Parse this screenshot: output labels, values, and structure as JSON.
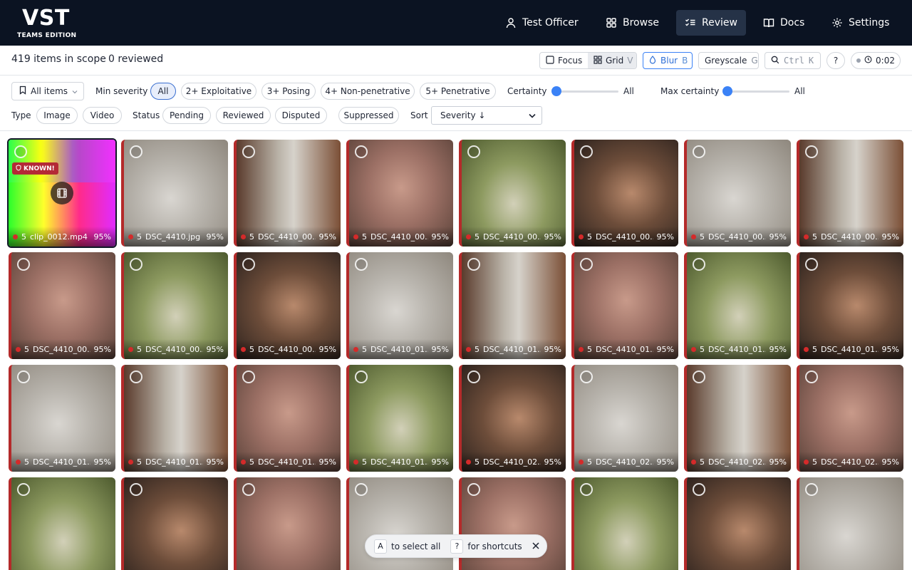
{
  "logo": {
    "title": "VST",
    "edition": "TEAMS EDITION"
  },
  "nav": [
    {
      "label": "Test Officer",
      "icon": "user-icon"
    },
    {
      "label": "Browse",
      "icon": "grid-icon"
    },
    {
      "label": "Review",
      "icon": "checklist-icon",
      "active": true
    },
    {
      "label": "Docs",
      "icon": "book-icon"
    },
    {
      "label": "Settings",
      "icon": "gear-icon"
    }
  ],
  "summary": {
    "in_scope": "419 items in scope",
    "reviewed": "0 reviewed",
    "focus_label": "Focus",
    "grid_label": "Grid",
    "grid_key": "V",
    "blur_label": "Blur",
    "blur_key": "B",
    "greyscale_label": "Greyscale",
    "greyscale_key": "G",
    "search_label": "Ctrl",
    "search_key": "K",
    "help_label": "?",
    "timer": "0:02"
  },
  "filters": {
    "scope_dropdown": "All items",
    "min_severity_label": "Min severity",
    "severity_options": [
      "All",
      "2+ Exploitative",
      "3+ Posing",
      "4+ Non-penetrative",
      "5+ Penetrative"
    ],
    "severity_selected": "All",
    "certainty_label": "Certainty",
    "certainty_value": "All",
    "certainty_level": 0,
    "max_certainty_label": "Max certainty",
    "max_certainty_value": "All",
    "max_certainty_level": 0,
    "type_label": "Type",
    "type_options": [
      "Image",
      "Video"
    ],
    "status_label": "Status",
    "status_options": [
      "Pending",
      "Reviewed",
      "Disputed",
      "Suppressed"
    ],
    "sort_label": "Sort",
    "sort_value": "Severity ↓"
  },
  "grid": {
    "tiles": [
      {
        "severity": "5",
        "name": "clip_0012.mp4",
        "certainty": "95%",
        "tone": "rainbow",
        "known": "KNOWN!",
        "video": true,
        "selected": true
      },
      {
        "severity": "5",
        "name": "DSC_4410.jpg",
        "certainty": "95%",
        "tone": "grey"
      },
      {
        "severity": "5",
        "name": "DSC_4410_00...",
        "certainty": "95%",
        "tone": "brown"
      },
      {
        "severity": "5",
        "name": "DSC_4410_00...",
        "certainty": "95%",
        "tone": "warm"
      },
      {
        "severity": "5",
        "name": "DSC_4410_00...",
        "certainty": "95%",
        "tone": "green"
      },
      {
        "severity": "5",
        "name": "DSC_4410_00...",
        "certainty": "95%",
        "tone": "dark"
      },
      {
        "severity": "5",
        "name": "DSC_4410_00...",
        "certainty": "95%",
        "tone": "grey"
      },
      {
        "severity": "5",
        "name": "DSC_4410_00...",
        "certainty": "95%",
        "tone": "brown"
      },
      {
        "severity": "5",
        "name": "DSC_4410_00...",
        "certainty": "95%",
        "tone": "warm"
      },
      {
        "severity": "5",
        "name": "DSC_4410_00...",
        "certainty": "95%",
        "tone": "green"
      },
      {
        "severity": "5",
        "name": "DSC_4410_00...",
        "certainty": "95%",
        "tone": "dark"
      },
      {
        "severity": "5",
        "name": "DSC_4410_01...",
        "certainty": "95%",
        "tone": "grey"
      },
      {
        "severity": "5",
        "name": "DSC_4410_01...",
        "certainty": "95%",
        "tone": "brown"
      },
      {
        "severity": "5",
        "name": "DSC_4410_01...",
        "certainty": "95%",
        "tone": "warm"
      },
      {
        "severity": "5",
        "name": "DSC_4410_01...",
        "certainty": "95%",
        "tone": "green"
      },
      {
        "severity": "5",
        "name": "DSC_4410_01...",
        "certainty": "95%",
        "tone": "dark"
      },
      {
        "severity": "5",
        "name": "DSC_4410_01...",
        "certainty": "95%",
        "tone": "grey"
      },
      {
        "severity": "5",
        "name": "DSC_4410_01...",
        "certainty": "95%",
        "tone": "brown"
      },
      {
        "severity": "5",
        "name": "DSC_4410_01...",
        "certainty": "95%",
        "tone": "warm"
      },
      {
        "severity": "5",
        "name": "DSC_4410_01...",
        "certainty": "95%",
        "tone": "green"
      },
      {
        "severity": "5",
        "name": "DSC_4410_02...",
        "certainty": "95%",
        "tone": "dark"
      },
      {
        "severity": "5",
        "name": "DSC_4410_02...",
        "certainty": "95%",
        "tone": "grey"
      },
      {
        "severity": "5",
        "name": "DSC_4410_02...",
        "certainty": "95%",
        "tone": "brown"
      },
      {
        "severity": "5",
        "name": "DSC_4410_02...",
        "certainty": "95%",
        "tone": "warm"
      },
      {
        "tone": "green"
      },
      {
        "tone": "dark"
      },
      {
        "tone": "warm"
      },
      {
        "tone": "grey"
      },
      {
        "tone": "warm"
      },
      {
        "tone": "green"
      },
      {
        "tone": "dark"
      },
      {
        "tone": "grey"
      }
    ]
  },
  "toast": {
    "key_select": "A",
    "text_select": "to select all",
    "key_help": "?",
    "text_help": "for shortcuts"
  },
  "colors": {
    "nav_bg": "#0b1322",
    "accent": "#3b82f6",
    "severity_red": "#d42a2a",
    "known_badge": "#b42a36"
  }
}
